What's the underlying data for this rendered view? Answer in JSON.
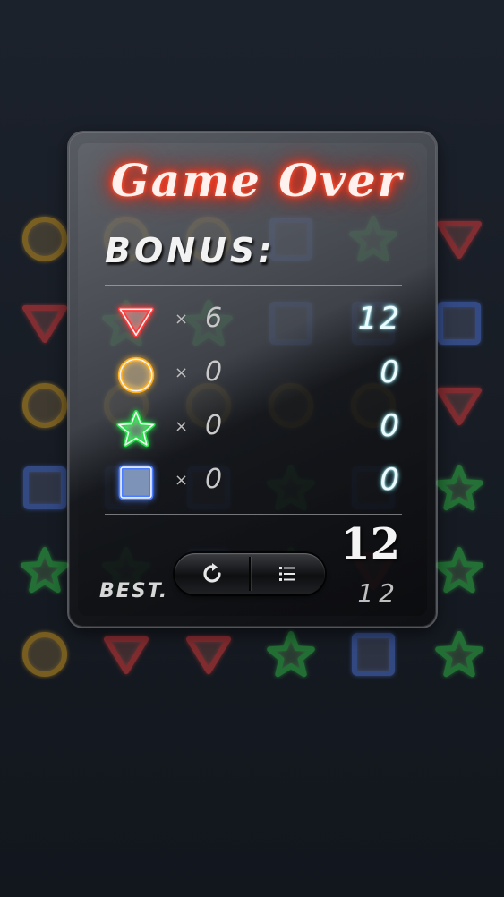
{
  "title": "Game Over",
  "bonus_label": "BONUS:",
  "bonus_rows": [
    {
      "shape": "triangle",
      "color": "#ff3b3b",
      "times": "×",
      "count": "6",
      "score": "12"
    },
    {
      "shape": "circle",
      "color": "#ffb020",
      "times": "×",
      "count": "0",
      "score": "0"
    },
    {
      "shape": "star",
      "color": "#27e04a",
      "times": "×",
      "count": "0",
      "score": "0"
    },
    {
      "shape": "square",
      "color": "#4a7dff",
      "times": "×",
      "count": "0",
      "score": "0"
    }
  ],
  "total_score": "12",
  "best_label": "BEST.",
  "best_score": "12",
  "buttons": {
    "restart_icon": "restart-icon",
    "menu_icon": "menu-list-icon"
  },
  "board": [
    [
      "circle",
      "circle",
      "circle",
      "square",
      "star",
      "triangle"
    ],
    [
      "triangle",
      "star",
      "star",
      "square",
      "square",
      "square"
    ],
    [
      "circle",
      "circle",
      "circle",
      "circle",
      "circle",
      "triangle"
    ],
    [
      "square",
      "square",
      "square",
      "star",
      "square",
      "star"
    ],
    [
      "star",
      "star",
      "square",
      "star",
      "triangle",
      "star"
    ],
    [
      "circle",
      "triangle",
      "triangle",
      "star",
      "square",
      "star"
    ]
  ],
  "colors": {
    "triangle": "#d83a3a",
    "circle": "#c99520",
    "star": "#2fb545",
    "square": "#4a6fd0",
    "score_glow": "#7ef2ff",
    "title_glow": "#ff3a1c"
  }
}
